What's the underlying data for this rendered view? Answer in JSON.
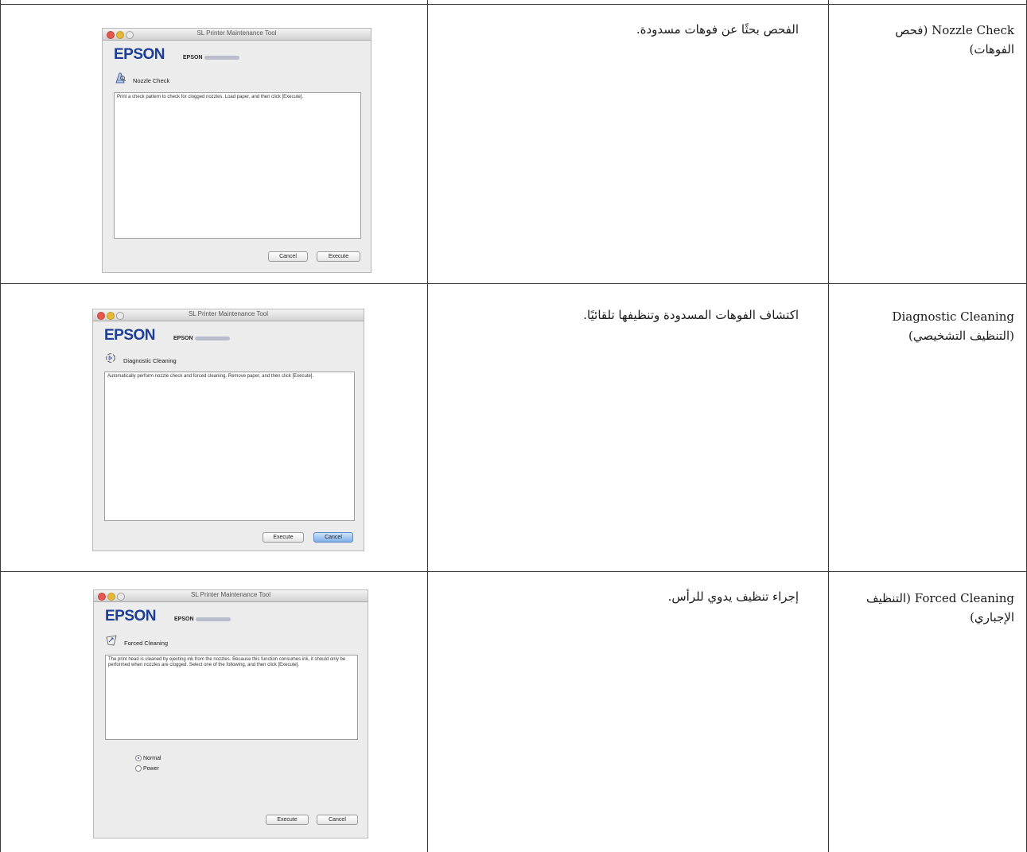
{
  "rows": [
    {
      "name": "Nozzle Check (فحص الفوهات)",
      "description": "الفحص بحثًا عن فوهات مسدودة.",
      "dialog": {
        "title": "SL Printer Maintenance Tool",
        "brand": "EPSON",
        "model_prefix": "EPSON",
        "icon": "nozzle-check-icon",
        "function_name": "Nozzle Check",
        "message": "Print a check pattern to check for clogged nozzles. Load paper, and then click [Execute].",
        "buttons": [
          "Cancel",
          "Execute"
        ]
      }
    },
    {
      "name": "Diagnostic Cleaning (التنظيف التشخيصي)",
      "description": "اكتشاف الفوهات المسدودة وتنظيفها تلقائيًا.",
      "dialog": {
        "title": "SL Printer Maintenance Tool",
        "brand": "EPSON",
        "model_prefix": "EPSON",
        "icon": "diagnostic-cleaning-icon",
        "function_name": "Diagnostic Cleaning",
        "message": "Automatically perform nozzle check and forced cleaning. Remove paper, and then click [Execute].",
        "buttons": [
          "Execute",
          "Cancel"
        ]
      }
    },
    {
      "name": "Forced Cleaning (التنظيف الإجباري)",
      "description": "إجراء تنظيف يدوي للرأس.",
      "dialog": {
        "title": "SL Printer Maintenance Tool",
        "brand": "EPSON",
        "model_prefix": "EPSON",
        "icon": "forced-cleaning-icon",
        "function_name": "Forced Cleaning",
        "message": "The print head is cleaned by ejecting ink from the nozzles. Because this function consumes ink, it should only be performed when nozzles are clogged. Select one of the following, and then click [Execute].",
        "options": [
          "Normal",
          "Power"
        ],
        "selected_option": "Normal",
        "buttons": [
          "Execute",
          "Cancel"
        ]
      }
    }
  ],
  "colors": {
    "brand": "#1c3f95",
    "default_button": "#7fb0ea",
    "grid_line": "#3a3a3a"
  }
}
